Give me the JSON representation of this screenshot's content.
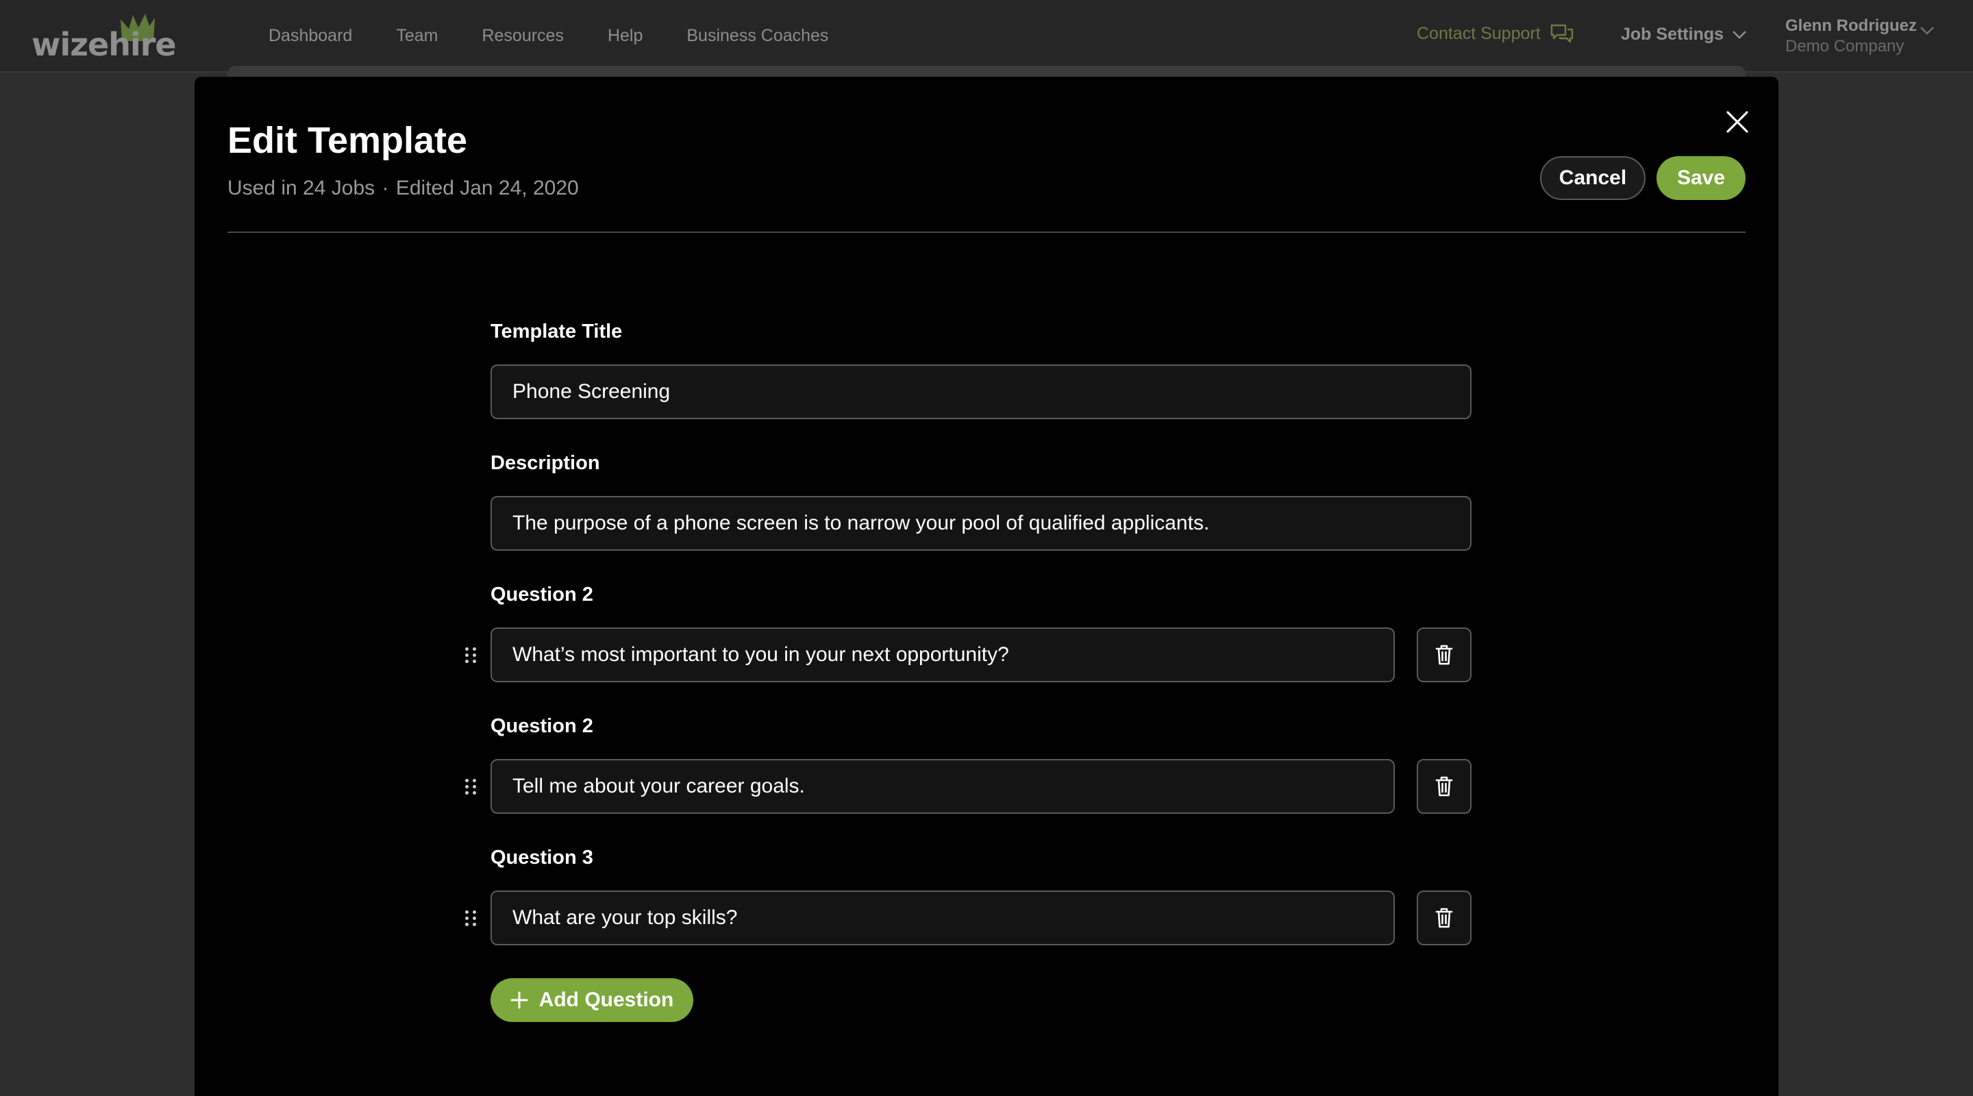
{
  "app": {
    "logo_text": "wizehire"
  },
  "nav": {
    "items": [
      {
        "label": "Dashboard"
      },
      {
        "label": "Team"
      },
      {
        "label": "Resources"
      },
      {
        "label": "Help"
      },
      {
        "label": "Business Coaches"
      }
    ],
    "contact_label": "Contact Support",
    "contact_icon": "chat-bubbles-icon",
    "job_settings_label": "Job Settings",
    "user_name": "Glenn Rodriguez",
    "user_company": "Demo Company"
  },
  "modal": {
    "title": "Edit Template",
    "meta_used": "Used in 24 Jobs",
    "meta_sep": "·",
    "meta_edited": "Edited Jan 24, 2020",
    "cancel_label": "Cancel",
    "save_label": "Save",
    "close_icon": "close-icon"
  },
  "form": {
    "title_label": "Template Title",
    "title_value": "Phone Screening",
    "description_label": "Description",
    "description_value": "The purpose of a phone screen is to narrow your pool of qualified applicants.",
    "questions": [
      {
        "label": "Question 2",
        "value": "What’s most important to you in your next opportunity?"
      },
      {
        "label": "Question 2",
        "value": "Tell me about your career goals."
      },
      {
        "label": "Question 3",
        "value": "What are your top skills?"
      }
    ],
    "add_question_label": "Add Question"
  },
  "colors": {
    "accent": "#7ca83c",
    "background": "#000000",
    "overlay": "#2e2e2e"
  }
}
